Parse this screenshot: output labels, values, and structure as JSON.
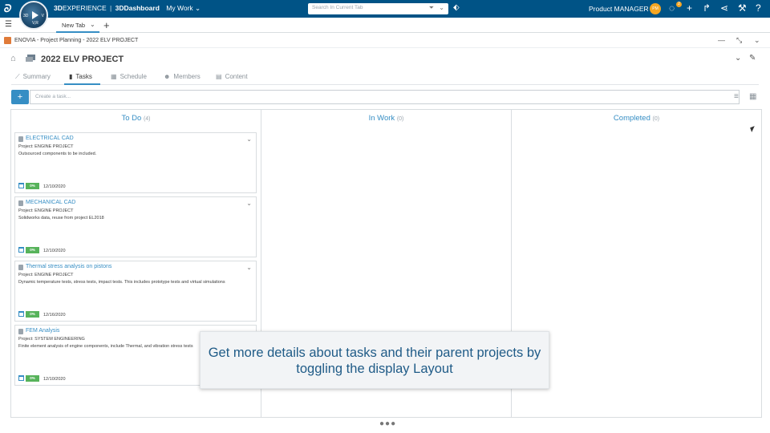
{
  "topbar": {
    "brand_3d": "3D",
    "brand_experience": "EXPERIENCE",
    "brand_sep": "|",
    "brand_dashboard": "3DDashboard",
    "mywork": "My Work",
    "search_placeholder": "Search In Current Tab",
    "user_name": "Product MANAGER",
    "avatar_initials": "PM",
    "notification_count": "2"
  },
  "compass": {
    "left": "3D",
    "right": "V",
    "bottom": "V,R"
  },
  "tabbar": {
    "tab_label": "New Tab"
  },
  "widget": {
    "title": "ENOVIA - Project Planning - 2022 ELV PROJECT"
  },
  "project": {
    "title": "2022 ELV PROJECT"
  },
  "nav_tabs": [
    {
      "label": "Summary",
      "icon": "chart-icon"
    },
    {
      "label": "Tasks",
      "icon": "clipboard-icon"
    },
    {
      "label": "Schedule",
      "icon": "calendar-icon"
    },
    {
      "label": "Members",
      "icon": "people-icon"
    },
    {
      "label": "Content",
      "icon": "document-icon"
    }
  ],
  "create": {
    "button": "+",
    "placeholder": "Create a task..."
  },
  "columns": [
    {
      "title": "To Do",
      "count": "(4)"
    },
    {
      "title": "In Work",
      "count": "(0)"
    },
    {
      "title": "Completed",
      "count": "(0)"
    }
  ],
  "cards": [
    {
      "title": "ELECTRICAL CAD",
      "project": "Project: ENGINE PROJECT",
      "description": "Outsourced components to be included.",
      "percent": "0%",
      "date": "12/10/2020"
    },
    {
      "title": "MECHANICAL CAD",
      "project": "Project: ENGINE PROJECT",
      "description": "Solidworks data, reuse from project EL2018",
      "percent": "0%",
      "date": "12/10/2020"
    },
    {
      "title": "Thermal stress analysis on pistons",
      "project": "Project: ENGINE PROJECT",
      "description": "Dynamic temperature tests, stress tests, impact tests. This includes prototype tests and virtual simulations",
      "percent": "0%",
      "date": "12/16/2020"
    },
    {
      "title": "FEM Analysis",
      "project": "Project: SYSTEM ENGINEERING",
      "description": "Finite element analysis of engine components,  include Thermal, and vibration stress tests",
      "percent": "0%",
      "date": "12/10/2020"
    }
  ],
  "overlay": {
    "text": "Get more details about tasks and their parent projects by toggling the display Layout"
  },
  "colors": {
    "topbar": "#005386",
    "accent": "#368ec4",
    "progress": "#57b35b",
    "badge": "#f5a623"
  }
}
